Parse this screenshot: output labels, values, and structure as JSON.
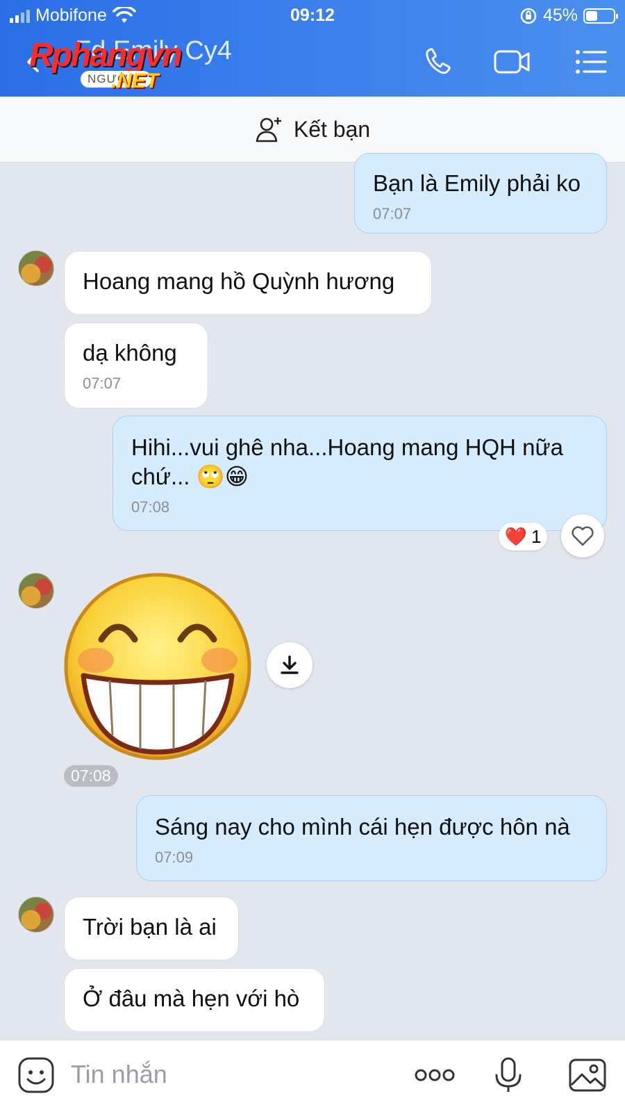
{
  "status_bar": {
    "carrier": "Mobifone",
    "time": "09:12",
    "battery": "45%",
    "battery_level": 0.45
  },
  "header": {
    "contact_name": "Fd Emily Cy4",
    "watermark_logo": "Rphangvn",
    "watermark_sub": "NGƯỜI...",
    "watermark_net": ".NET"
  },
  "friend_bar": {
    "label": "Kết bạn"
  },
  "messages": [
    {
      "text": "Bạn là Emily phải ko",
      "time": "07:07"
    },
    {
      "text": "Hoang mang hồ Quỳnh hương"
    },
    {
      "text": "dạ không",
      "time": "07:07"
    },
    {
      "text": "Hihi...vui ghê nha...Hoang mang HQH nữa chứ...",
      "emoji": "🙄😁",
      "time": "07:08",
      "reaction": {
        "emoji": "❤️",
        "count": "1"
      }
    },
    {
      "sticker": "grinning-sticker",
      "time": "07:08"
    },
    {
      "text": "Sáng nay cho mình cái hẹn được hôn nà",
      "time": "07:09"
    },
    {
      "text": "Trời bạn là ai"
    },
    {
      "text": "Ở đâu mà hẹn với hò"
    }
  ],
  "input": {
    "placeholder": "Tin nhắn"
  },
  "colors": {
    "header_start": "#2b6fe8",
    "header_end": "#4a90ef",
    "outgoing_bubble": "#d5ecff",
    "incoming_bubble": "#ffffff",
    "chat_bg": "#e2e6ee"
  }
}
